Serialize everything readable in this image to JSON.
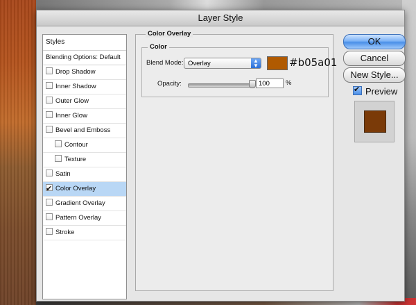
{
  "dialog": {
    "title": "Layer Style"
  },
  "styles_panel": {
    "header": "Styles",
    "blending_options": "Blending Options: Default",
    "items": [
      {
        "label": "Drop Shadow",
        "checked": false,
        "sub": false
      },
      {
        "label": "Inner Shadow",
        "checked": false,
        "sub": false
      },
      {
        "label": "Outer Glow",
        "checked": false,
        "sub": false
      },
      {
        "label": "Inner Glow",
        "checked": false,
        "sub": false
      },
      {
        "label": "Bevel and Emboss",
        "checked": false,
        "sub": false
      },
      {
        "label": "Contour",
        "checked": false,
        "sub": true
      },
      {
        "label": "Texture",
        "checked": false,
        "sub": true
      },
      {
        "label": "Satin",
        "checked": false,
        "sub": false
      },
      {
        "label": "Color Overlay",
        "checked": true,
        "sub": false,
        "selected": true
      },
      {
        "label": "Gradient Overlay",
        "checked": false,
        "sub": false
      },
      {
        "label": "Pattern Overlay",
        "checked": false,
        "sub": false
      },
      {
        "label": "Stroke",
        "checked": false,
        "sub": false
      }
    ]
  },
  "options": {
    "section_title": "Color Overlay",
    "color_group_title": "Color",
    "blend_mode_label": "Blend Mode:",
    "blend_mode_value": "Overlay",
    "color_hex": "#b05a01",
    "color_annotation": "#b05a01",
    "opacity_label": "Opacity:",
    "opacity_value": "100",
    "opacity_unit": "%",
    "opacity_level": 100
  },
  "buttons": {
    "ok": "OK",
    "cancel": "Cancel",
    "new_style": "New Style...",
    "preview_label": "Preview",
    "preview_checked": true
  },
  "preview": {
    "swatch_color": "#7a3a08"
  }
}
